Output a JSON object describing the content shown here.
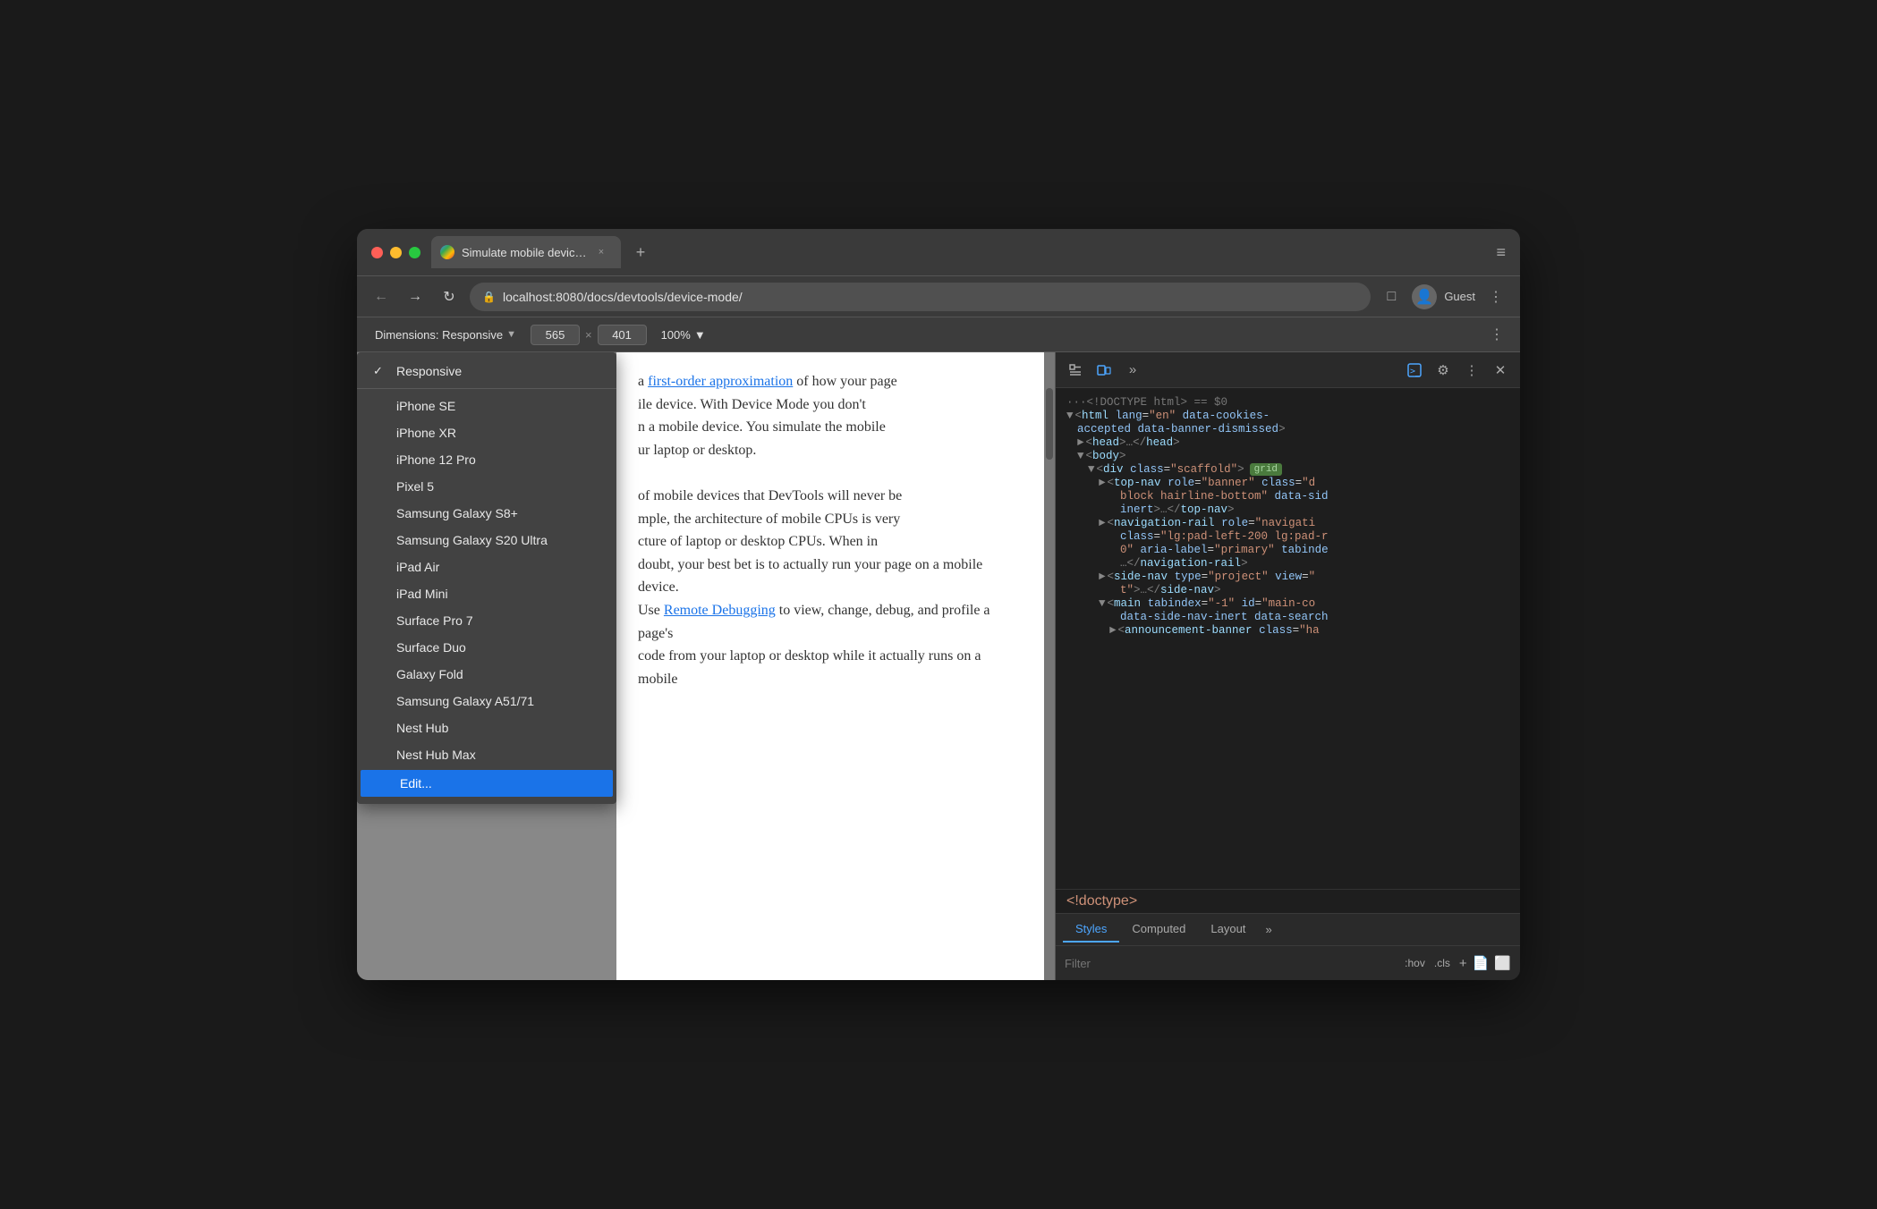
{
  "browser": {
    "tab_title": "Simulate mobile devices with D",
    "tab_close": "×",
    "new_tab": "+",
    "window_menu": "≡",
    "address": "localhost:8080/docs/devtools/device-mode/",
    "guest_label": "Guest"
  },
  "toolbar": {
    "dimensions_label": "Dimensions: Responsive",
    "width_value": "565",
    "height_value": "401",
    "zoom_label": "100%",
    "more_options": "⋮"
  },
  "dropdown": {
    "items": [
      {
        "id": "responsive",
        "label": "Responsive",
        "selected": true,
        "indent": false
      },
      {
        "id": "iphone-se",
        "label": "iPhone SE",
        "selected": false,
        "indent": true
      },
      {
        "id": "iphone-xr",
        "label": "iPhone XR",
        "selected": false,
        "indent": true
      },
      {
        "id": "iphone-12-pro",
        "label": "iPhone 12 Pro",
        "selected": false,
        "indent": true
      },
      {
        "id": "pixel-5",
        "label": "Pixel 5",
        "selected": false,
        "indent": true
      },
      {
        "id": "samsung-s8",
        "label": "Samsung Galaxy S8+",
        "selected": false,
        "indent": true
      },
      {
        "id": "samsung-s20",
        "label": "Samsung Galaxy S20 Ultra",
        "selected": false,
        "indent": true
      },
      {
        "id": "ipad-air",
        "label": "iPad Air",
        "selected": false,
        "indent": true
      },
      {
        "id": "ipad-mini",
        "label": "iPad Mini",
        "selected": false,
        "indent": true
      },
      {
        "id": "surface-pro",
        "label": "Surface Pro 7",
        "selected": false,
        "indent": true
      },
      {
        "id": "surface-duo",
        "label": "Surface Duo",
        "selected": false,
        "indent": true
      },
      {
        "id": "galaxy-fold",
        "label": "Galaxy Fold",
        "selected": false,
        "indent": true
      },
      {
        "id": "samsung-a51",
        "label": "Samsung Galaxy A51/71",
        "selected": false,
        "indent": true
      },
      {
        "id": "nest-hub",
        "label": "Nest Hub",
        "selected": false,
        "indent": true
      },
      {
        "id": "nest-hub-max",
        "label": "Nest Hub Max",
        "selected": false,
        "indent": true
      },
      {
        "id": "edit",
        "label": "Edit...",
        "selected": false,
        "highlighted": true,
        "indent": false
      }
    ]
  },
  "page_content": {
    "text1": "a first-order approximation of how your page",
    "link1": "first-order approximation",
    "text2": "ile device. With Device Mode you don't",
    "text3": "n a mobile device. You simulate the mobile",
    "text4": "ur laptop or desktop.",
    "text5": "of mobile devices that DevTools will never be",
    "text6": "mple, the architecture of mobile CPUs is very",
    "text7": "cture of laptop or desktop CPUs. When in",
    "text8": "doubt, your best bet is to actually run your page on a mobile device.",
    "text9": "Use",
    "link2": "Remote Debugging",
    "text10": "to view, change, debug, and profile a page's",
    "text11": "code from your laptop or desktop while it actually runs on a mobile"
  },
  "devtools": {
    "html_lines": [
      {
        "indent": 0,
        "content": "···<!DOCTYPE html> == $0",
        "type": "comment"
      },
      {
        "indent": 0,
        "content": "<html lang=\"en\" data-cookies-accepted data-banner-dismissed>",
        "type": "tag",
        "open": true
      },
      {
        "indent": 1,
        "content": "<head>…</head>",
        "type": "tag",
        "collapsed": true
      },
      {
        "indent": 1,
        "content": "<body>",
        "type": "tag",
        "open": true
      },
      {
        "indent": 2,
        "content": "<div class=\"scaffold\">",
        "type": "tag",
        "badge": "grid"
      },
      {
        "indent": 3,
        "content": "<top-nav role=\"banner\" class=\"d block hairline-bottom\" data-sid inert>…</top-nav>",
        "type": "tag",
        "collapsed": true
      },
      {
        "indent": 3,
        "content": "<navigation-rail role=\"navigati class=\"lg:pad-left-200 lg:pad-r 0\" aria-label=\"primary\" tabinde …></navigation-rail>",
        "type": "tag"
      },
      {
        "indent": 3,
        "content": "<side-nav type=\"project\" view= t>…</side-nav>",
        "type": "tag",
        "collapsed": true
      },
      {
        "indent": 3,
        "content": "<main tabindex=\"-1\" id=\"main-co data-side-nav-inert data-search",
        "type": "tag"
      },
      {
        "indent": 4,
        "content": "<announcement-banner class=\"ha",
        "type": "tag"
      }
    ],
    "doctype": "<!doctype>",
    "tabs": [
      "Styles",
      "Computed",
      "Layout"
    ],
    "active_tab": "Styles",
    "filter_placeholder": "Filter",
    "filter_pseudo": ":hov",
    "filter_cls": ".cls"
  }
}
